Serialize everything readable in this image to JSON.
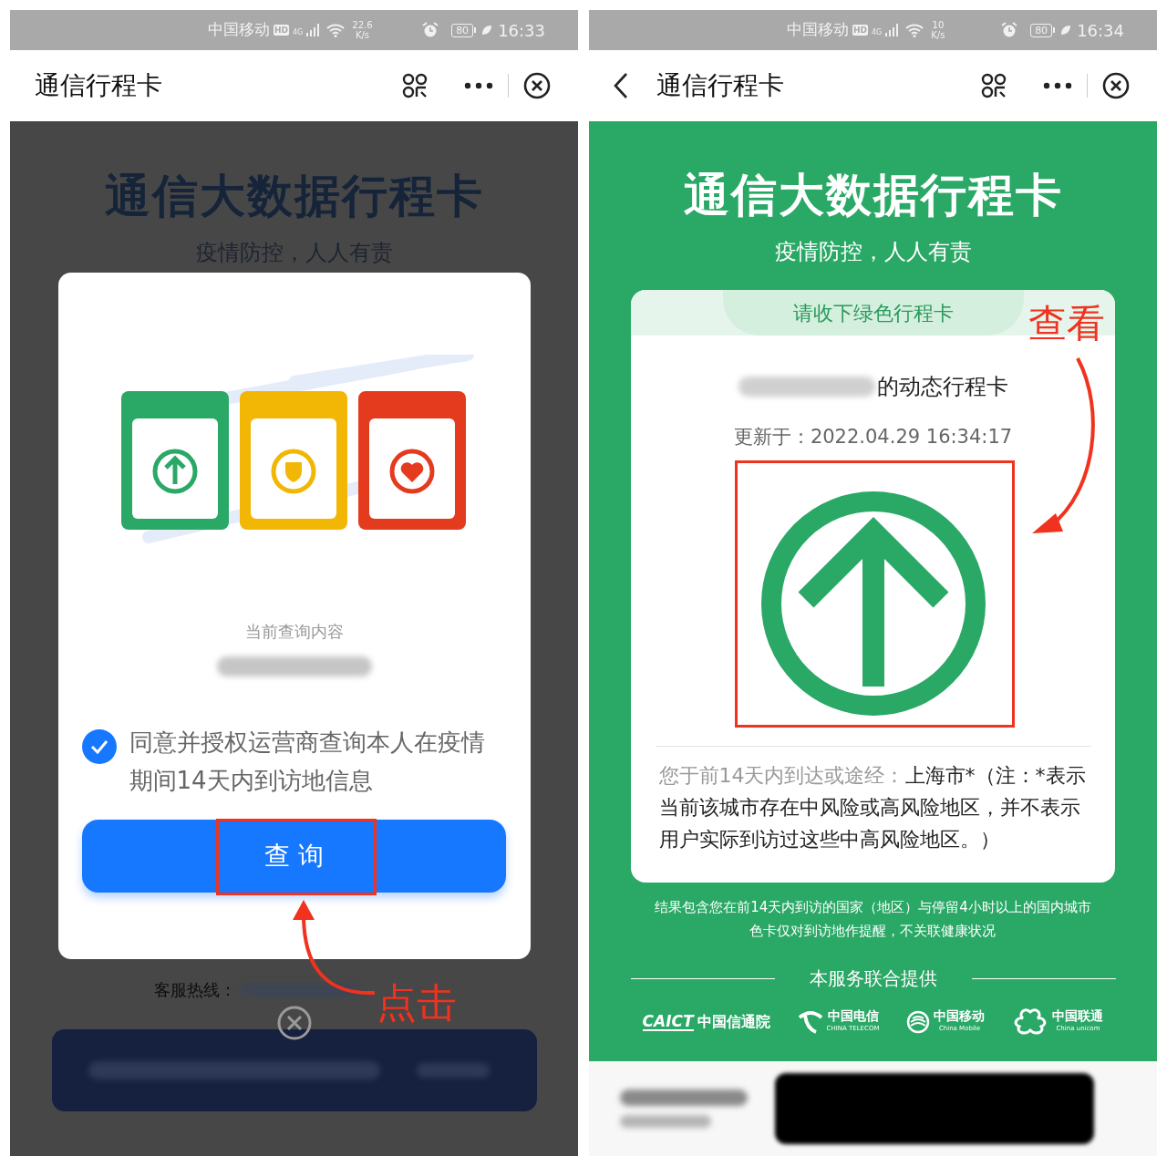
{
  "screens": [
    {
      "kind": "consent",
      "status_bar": {
        "carrier": "中国移动",
        "hd": "HD",
        "network": "4G",
        "speed": "22.6",
        "speed_unit": "K/s",
        "battery": "80",
        "time": "16:33"
      },
      "nav": {
        "title": "通信行程卡",
        "back": false
      },
      "title": "通信大数据行程卡",
      "subtitle": "疫情防控，人人有责",
      "dialog": {
        "query_label": "当前查询内容",
        "consent": {
          "checked": true,
          "text": "同意并授权运营商查询本人在疫情期间14天内到访地信息"
        },
        "button": "查 询"
      },
      "hotline_label": "客服热线：",
      "annotation": "点击"
    },
    {
      "kind": "result",
      "status_bar": {
        "carrier": "中国移动",
        "hd": "HD",
        "network": "4G",
        "speed": "10",
        "speed_unit": "K/s",
        "battery": "80",
        "time": "16:34"
      },
      "nav": {
        "title": "通信行程卡",
        "back": true
      },
      "title": "通信大数据行程卡",
      "subtitle": "疫情防控，人人有责",
      "card": {
        "tab": "请收下绿色行程卡",
        "owner_suffix": "的动态行程卡",
        "updated": "更新于：2022.04.29 16:34:17",
        "route_label": "您于前14天内到达或途经：",
        "route_value": "上海市*（注：*表示当前该城市存在中风险或高风险地区，并不表示用户实际到访过这些中高风险地区。）"
      },
      "notes": [
        "结果包含您在前14天内到访的国家（地区）与停留4小时以上的国内城市",
        "色卡仅对到访地作提醒，不关联健康状况"
      ],
      "providers_heading": "本服务联合提供",
      "providers": [
        {
          "kind": "caict",
          "mark": "CAICT",
          "name": "中国信通院"
        },
        {
          "kind": "telecom",
          "name": "中国电信",
          "english": "CHINA TELECOM"
        },
        {
          "kind": "mobile",
          "name": "中国移动",
          "english": "China Mobile"
        },
        {
          "kind": "unicom",
          "name": "中国联通",
          "english": "China unicom"
        }
      ],
      "annotation": "查看"
    }
  ]
}
